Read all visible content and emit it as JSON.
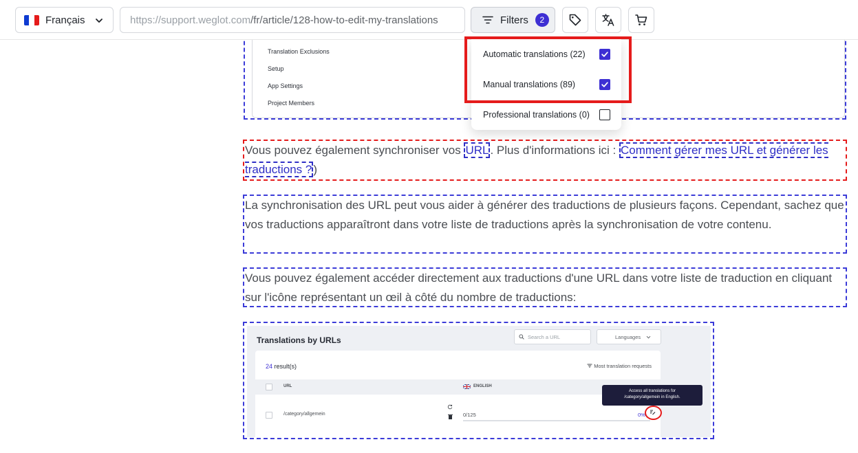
{
  "toolbar": {
    "language": {
      "label": "Français",
      "flag_colors": [
        "#0f3bd1",
        "#ffffff",
        "#e51b1b"
      ]
    },
    "url": {
      "host": "https://support.weglot.com",
      "path": "/fr/article/128-how-to-edit-my-translations"
    },
    "filters": {
      "label": "Filters",
      "count": "2"
    },
    "icons": [
      "tag-icon",
      "translate-icon",
      "cart-icon"
    ]
  },
  "filter_menu": {
    "items": [
      {
        "label": "Automatic translations (22)",
        "checked": true
      },
      {
        "label": "Manual translations (89)",
        "checked": true
      },
      {
        "label": "Professional translations (0)",
        "checked": false
      }
    ]
  },
  "screenshot_top": {
    "menu_items": [
      "Translation Exclusions",
      "Setup",
      "App Settings",
      "Project Members"
    ]
  },
  "content": {
    "p1": {
      "before": "Vous pouvez également synchroniser vos ",
      "link1": "URL",
      "middle": ". Plus d'informations ici : ",
      "link2": "Comment gérer mes URL et générer les traductions ?"
    },
    "p1_end": ")",
    "p2": "La synchronisation des URL peut vous aider à générer des traductions de plusieurs façons. Cependant, sachez que vos traductions apparaîtront dans votre liste de traductions après la synchronisation de votre contenu.",
    "p3": "Vous pouvez également accéder directement aux traductions d'une URL dans votre liste de traduction en cliquant sur l'icône représentant un œil à côté du nombre de traductions:"
  },
  "screenshot_bottom": {
    "title": "Translations by URLs",
    "search_placeholder": "Search a URL",
    "languages": "Languages",
    "results_count": "24",
    "results_label": " result(s)",
    "sort_label": "Most translation requests",
    "col_url": "URL",
    "col_lang": "ENGLISH",
    "row_url": "/category/allgemein",
    "row_count": "0/125",
    "row_pct": "0%",
    "tooltip_line1": "Access all translations for",
    "tooltip_line2": "/category/allgemein in English."
  },
  "colors": {
    "accent": "#3d2fd3",
    "highlight": "#e51b1b",
    "dashed_outline": "#3b3bd8"
  }
}
